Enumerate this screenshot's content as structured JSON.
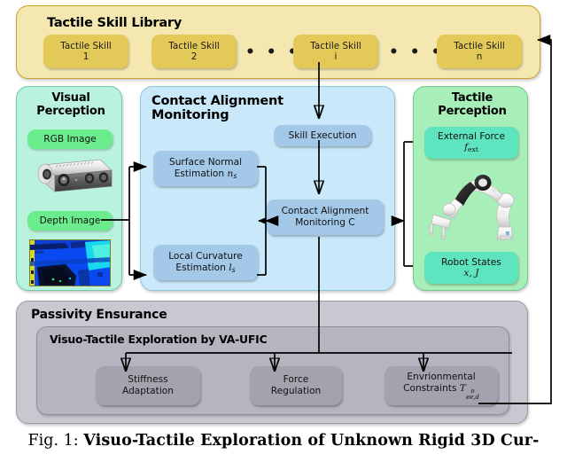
{
  "figure": {
    "caption_prefix": "Fig. 1:",
    "caption_title": "Visuo-Tactile Exploration of Unknown Rigid 3D Cur-"
  },
  "skill_library": {
    "title": "Tactile Skill Library",
    "skills": [
      {
        "line1": "Tactile Skill",
        "line2": "1"
      },
      {
        "line1": "Tactile Skill",
        "line2": "2"
      },
      {
        "line1": "Tactile Skill",
        "line2": "i"
      },
      {
        "line1": "Tactile Skill",
        "line2": "n"
      }
    ],
    "ellipsis": "• • •"
  },
  "visual_perception": {
    "title_line1": "Visual",
    "title_line2": "Perception",
    "rgb_label": "RGB Image",
    "depth_label": "Depth Image",
    "rgb_icon": "depth-camera-image",
    "depth_icon": "depth-map-image"
  },
  "contact_monitoring": {
    "title_line1": "Contact Alignment",
    "title_line2": "Monitoring",
    "skill_execution": "Skill Execution",
    "surface_normal_line1": "Surface Normal",
    "surface_normal_line2": "Estimation",
    "surface_normal_symbol": "n",
    "surface_normal_sub": "s",
    "local_curvature_line1": "Local Curvature",
    "local_curvature_line2": "Estimation",
    "local_curvature_symbol": "l",
    "local_curvature_sub": "s",
    "monitor_line1": "Contact Alignment",
    "monitor_line2": "Monitoring C"
  },
  "tactile_perception": {
    "title_line1": "Tactile",
    "title_line2": "Perception",
    "external_force_label": "External Force",
    "external_force_symbol": "f",
    "external_force_sub": "ext",
    "robot_states_label": "Robot States",
    "robot_states_symbol_x": "x",
    "robot_states_symbol_comma": ",",
    "robot_states_symbol_j": "J",
    "robot_icon": "robot-arm-image"
  },
  "passivity": {
    "title": "Passivity Ensurance",
    "vaufic_title": "Visuo-Tactile Exploration by VA-UFIC",
    "blocks": [
      {
        "line1": "Stiffness",
        "line2": "Adaptation"
      },
      {
        "line1": "Force",
        "line2": "Regulation"
      },
      {
        "line1": "Envrionmental",
        "line2": "Constraints"
      }
    ],
    "constraint_symbol": "T",
    "constraint_sup": "o",
    "constraint_sub": "ee,d"
  },
  "colors": {
    "library_bg": "#f4e7b0",
    "library_pill": "#e3ca58",
    "visual_bg": "#b9f2dd",
    "visual_pill": "#6ced8d",
    "monitor_bg": "#c9e9fa",
    "monitor_pill": "#a3c8e8",
    "tactile_bg": "#a8eeb8",
    "tactile_pill": "#5fe4c0",
    "passivity_bg": "#c8c8d0",
    "vaufic_bg": "#b5b5c0",
    "vaufic_pill": "#a3a3ae",
    "wire": "#000000"
  }
}
